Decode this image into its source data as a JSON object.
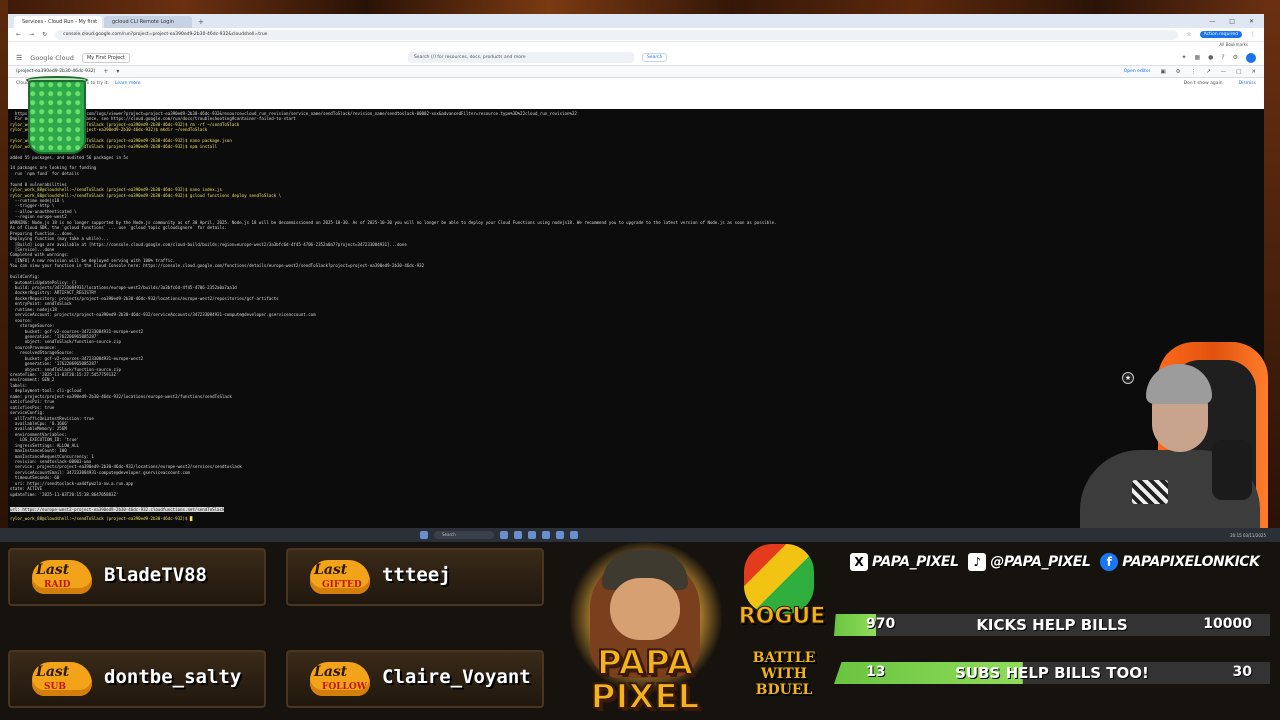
{
  "browser": {
    "tabs": [
      {
        "label": "Services - Cloud Run - My first"
      },
      {
        "label": "gcloud CLI Remote Login"
      }
    ],
    "url": "console.cloud.google.com/run?project=project-ea390ed9-2b30-46dc-932&cloudshell=true",
    "account_badge": "Action required",
    "bookmarks_label": "All Bookmarks"
  },
  "gcloud": {
    "logo": "Google Cloud",
    "project": "My First Project",
    "search_placeholder": "Search (/) for resources, docs, products and more",
    "search_button": "Search",
    "shell_tab": "(project-ea390ed9-2b30-46dc-932)",
    "open_editor": "Open editor",
    "info_text": "Cloud Shell session. Type gemini to try it.",
    "info_link": "Learn more",
    "dont_show": "Don't show again",
    "dismiss": "Dismiss"
  },
  "terminal": {
    "lines": [
      {
        "t": "  https://console.cloud.google.com/logs/viewer?project=project-ea390ed9-2b30-46dc-932&resource=cloud_run_revision/service_name/sendToSlack/revision_name/sendtoslack-00002-xxx&advancedFilter=resource.type%3D%22cloud_run_revision%22",
        "c": ""
      },
      {
        "t": "  For more troubleshooting guidance, see https://cloud.google.com/run/docs/troubleshooting#container-failed-to-start",
        "c": ""
      },
      {
        "t": "rylor_work_88@cloudshell:~/sendToSlack (project-ea390ed9-2b30-46dc-932)$ rm -rf ~/sendToSlack",
        "c": "y"
      },
      {
        "t": "rylor_work_88@cloudshell:~ (project-ea390ed9-2b30-46dc-932)$ mkdir ~/sendToSlack",
        "c": "y"
      },
      {
        "t": "",
        "c": ""
      },
      {
        "t": "rylor_work_88@cloudshell:~/sendToSlack (project-ea390ed9-2b30-46dc-932)$ nano package.json",
        "c": "y"
      },
      {
        "t": "rylor_work_88@cloudshell:~/sendToSlack (project-ea390ed9-2b30-46dc-932)$ npm install",
        "c": "y"
      },
      {
        "t": "",
        "c": ""
      },
      {
        "t": "added 55 packages, and audited 56 packages in 5s",
        "c": ""
      },
      {
        "t": "",
        "c": ""
      },
      {
        "t": "14 packages are looking for funding",
        "c": ""
      },
      {
        "t": "  run `npm fund` for details",
        "c": ""
      },
      {
        "t": "",
        "c": ""
      },
      {
        "t": "found 0 vulnerabilities",
        "c": ""
      },
      {
        "t": "rylor_work_88@cloudshell:~/sendToSlack (project-ea390ed9-2b30-46dc-932)$ nano index.js",
        "c": "y"
      },
      {
        "t": "rylor_work_88@cloudshell:~/sendToSlack (project-ea390ed9-2b30-46dc-932)$ gcloud functions deploy sendToSlack \\",
        "c": "y"
      },
      {
        "t": "  --runtime nodejs18 \\",
        "c": ""
      },
      {
        "t": "  --trigger-http \\",
        "c": ""
      },
      {
        "t": "  --allow-unauthenticated \\",
        "c": ""
      },
      {
        "t": "  --region europe-west2",
        "c": ""
      },
      {
        "t": "WARNING: Node.js 18 is no longer supported by the Node.js community as of 30 April, 2025. Node.js 18 will be decommissioned on 2025-10-30. As of 2025-10-30 you will no longer be able to deploy your Cloud Functions using nodejs18. We recommend you to upgrade to the latest version of Node.js as soon as possible.",
        "c": ""
      },
      {
        "t": "As of Cloud SDK, the `gcloud functions` ... use `gcloud topic gcloudignore` for details.",
        "c": ""
      },
      {
        "t": "Preparing function...done.",
        "c": ""
      },
      {
        "t": "Deploying function (may take a while)...",
        "c": ""
      },
      {
        "t": "  [Build] Logs are available at [https://console.cloud.google.com/cloud-build/builds;region=europe-west2/3a3bfc6d-4f45-4706-2352a0a7?project=347233084931]...done",
        "c": ""
      },
      {
        "t": "  [Service]...done",
        "c": ""
      },
      {
        "t": "Completed with warnings:",
        "c": ""
      },
      {
        "t": "  [INFO] A new revision will be deployed serving with 100% traffic.",
        "c": ""
      },
      {
        "t": "You can view your function in the Cloud Console here: https://console.cloud.google.com/functions/details/europe-west2/sendToSlack?project=project-ea390ed9-2b30-46dc-932",
        "c": ""
      },
      {
        "t": "",
        "c": ""
      },
      {
        "t": "buildConfig:",
        "c": ""
      },
      {
        "t": "  automaticUpdatePolicy: {}",
        "c": ""
      },
      {
        "t": "  build: projects/347233084931/locations/europe-west2/builds/3a3bfc6d-4f45-4706-2352a0a7aa1d",
        "c": ""
      },
      {
        "t": "  dockerRegistry: ARTIFACT_REGISTRY",
        "c": ""
      },
      {
        "t": "  dockerRepository: projects/project-ea390ed9-2b30-46dc-932/locations/europe-west2/repositories/gcf-artifacts",
        "c": ""
      },
      {
        "t": "  entryPoint: sendToSlack",
        "c": ""
      },
      {
        "t": "  runtime: nodejs18",
        "c": ""
      },
      {
        "t": "  serviceAccount: projects/project-ea390ed9-2b30-46dc-932/serviceAccounts/347233084931-compute@developer.gserviceaccount.com",
        "c": ""
      },
      {
        "t": "  source:",
        "c": ""
      },
      {
        "t": "    storageSource:",
        "c": ""
      },
      {
        "t": "      bucket: gcf-v2-sources-347233084931-europe-west2",
        "c": ""
      },
      {
        "t": "      generation: '1762206965085287'",
        "c": ""
      },
      {
        "t": "      object: sendToSlack/function-source.zip",
        "c": ""
      },
      {
        "t": "  sourceProvenance:",
        "c": ""
      },
      {
        "t": "    resolvedStorageSource:",
        "c": ""
      },
      {
        "t": "      bucket: gcf-v2-sources-347233084931-europe-west2",
        "c": ""
      },
      {
        "t": "      generation: '1762206965085287'",
        "c": ""
      },
      {
        "t": "      object: sendToSlack/function-source.zip",
        "c": ""
      },
      {
        "t": "createTime: '2025-11-03T20:15:27.545775913Z'",
        "c": ""
      },
      {
        "t": "environment: GEN_2",
        "c": ""
      },
      {
        "t": "labels:",
        "c": ""
      },
      {
        "t": "  deployment-tool: cli-gcloud",
        "c": ""
      },
      {
        "t": "name: projects/project-ea390ed9-2b30-46dc-932/locations/europe-west2/functions/sendToSlack",
        "c": ""
      },
      {
        "t": "satisfiesPzi: true",
        "c": ""
      },
      {
        "t": "satisfiesPzs: true",
        "c": ""
      },
      {
        "t": "serviceConfig:",
        "c": ""
      },
      {
        "t": "  allTrafficOnLatestRevision: true",
        "c": ""
      },
      {
        "t": "  availableCpu: '0.1666'",
        "c": ""
      },
      {
        "t": "  availableMemory: 256M",
        "c": ""
      },
      {
        "t": "  environmentVariables:",
        "c": ""
      },
      {
        "t": "    LOG_EXECUTION_ID: 'true'",
        "c": ""
      },
      {
        "t": "  ingressSettings: ALLOW_ALL",
        "c": ""
      },
      {
        "t": "  maxInstanceCount: 100",
        "c": ""
      },
      {
        "t": "  maxInstanceRequestConcurrency: 1",
        "c": ""
      },
      {
        "t": "  revision: sendtoslack-00003-wax",
        "c": ""
      },
      {
        "t": "  service: projects/project-ea390ed9-2b30-46dc-932/locations/europe-west2/services/sendtoslack",
        "c": ""
      },
      {
        "t": "  serviceAccountEmail: 347233084931-compute@developer.gserviceaccount.com",
        "c": ""
      },
      {
        "t": "  timeoutSeconds: 60",
        "c": ""
      },
      {
        "t": "  uri: https://sendtoslack-ua4dfpwzla-nw.a.run.app",
        "c": ""
      },
      {
        "t": "state: ACTIVE",
        "c": ""
      },
      {
        "t": "updateTime: '2025-11-03T20:15:38.864705883Z'",
        "c": ""
      },
      {
        "t": "url: https://europe-west2-project-ea390ed9-2b30-46dc-932.cloudfunctions.net/sendToSlack",
        "c": "sel"
      },
      {
        "t": "rylor_work_88@cloudshell:~/sendToSlack (project-ea390ed9-2b30-46dc-932)$ █",
        "c": "y"
      }
    ]
  },
  "taskbar": {
    "search_placeholder": "Search",
    "clock": "20:15 03/11/2025"
  },
  "overlay": {
    "events": [
      {
        "kind": "RAID",
        "name": "BladeTV88"
      },
      {
        "kind": "GIFTED",
        "name": "ttteej"
      },
      {
        "kind": "SUB",
        "name": "dontbe_salty"
      },
      {
        "kind": "FOLLOW",
        "name": "Claire_Voyant"
      }
    ],
    "last_label": "Last",
    "brand": "PAPA PIXEL",
    "rogue": "ROGUE",
    "battle": "BATTLE WITH BDUEL",
    "socials": [
      {
        "icon": "x-icon",
        "glyph": "X",
        "handle": "PAPA_PIXEL"
      },
      {
        "icon": "tiktok-icon",
        "glyph": "♪",
        "handle": "@PAPA_PIXEL"
      },
      {
        "icon": "facebook-icon",
        "glyph": "f",
        "handle": "PAPAPIXELONKICK"
      }
    ],
    "goals": [
      {
        "current": "970",
        "label": "KICKS HELP BILLS",
        "target": "10000",
        "fraction": 0.097
      },
      {
        "current": "13",
        "label": "SUBS HELP BILLS TOO!",
        "target": "30",
        "fraction": 0.433
      }
    ]
  },
  "colors": {
    "goal_fill": "#6ac43f",
    "brand_gold": "#f4b319",
    "prompt_yellow": "#f0e060",
    "terminal_bg": "#0c0c0c"
  }
}
